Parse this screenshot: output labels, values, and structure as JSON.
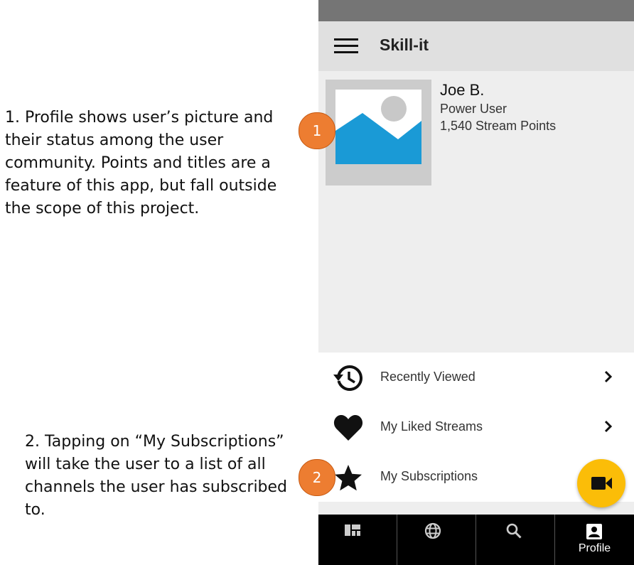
{
  "annotations": {
    "one": "1. Profile shows user’s picture and their status among the user community. Points and titles are a feature of this app, but fall outside the scope of this project.",
    "two": "2. Tapping on “My Subscriptions” will take the user to a list of all channels the user has subscribed to."
  },
  "badges": {
    "one": "1",
    "two": "2"
  },
  "app": {
    "title": "Skill-it"
  },
  "profile": {
    "name": "Joe B.",
    "title": "Power User",
    "points": "1,540 Stream Points"
  },
  "menu": {
    "items": [
      {
        "label": "Recently Viewed",
        "icon": "history-icon"
      },
      {
        "label": "My Liked Streams",
        "icon": "heart-icon"
      },
      {
        "label": "My Subscriptions",
        "icon": "star-icon"
      }
    ]
  },
  "bottom_nav": {
    "items": [
      {
        "icon": "dashboard-icon"
      },
      {
        "icon": "globe-icon"
      },
      {
        "icon": "search-icon"
      },
      {
        "icon": "profile-icon",
        "label": "Profile"
      }
    ]
  },
  "colors": {
    "fab": "#fbbd08",
    "badge": "#ed7d31",
    "avatar_placeholder": "#1a9ad6"
  }
}
